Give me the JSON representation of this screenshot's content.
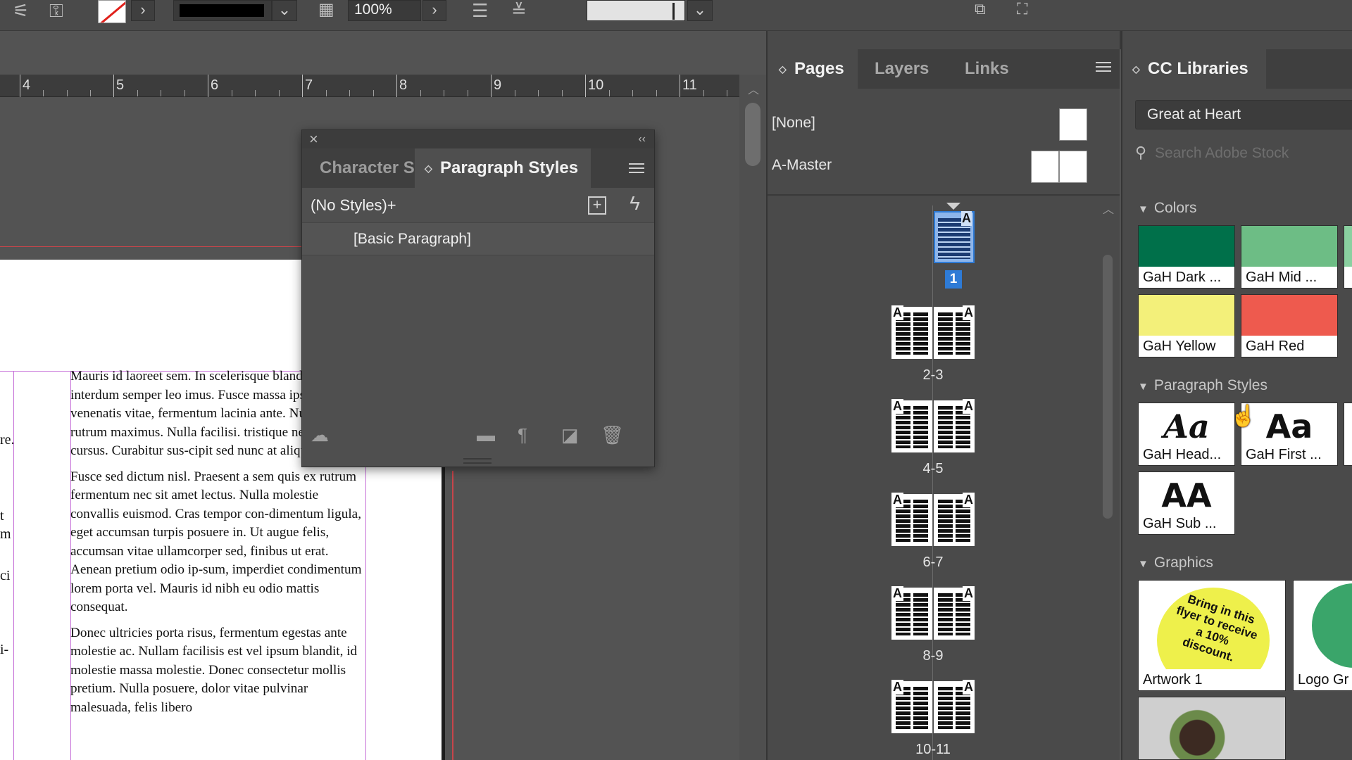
{
  "toolbar": {
    "zoom": "100%"
  },
  "ruler": {
    "labels": [
      "4",
      "5",
      "6",
      "7",
      "8",
      "9",
      "10",
      "11"
    ]
  },
  "document": {
    "left_fragments": [
      "re.",
      "t",
      "m",
      "ci",
      "i-"
    ],
    "paragraphs": [
      "Mauris id laoreet sem. In scelerisque blandit. Donec interdum semper leo imus. Fusce massa ipsum, venenatis vitae, fermentum lacinia ante. Nunc arcu rutrum maximus. Nulla facilisi. tristique nec ante quis cursus. Curabitur sus-cipit sed nunc at aliquet.",
      "Fusce sed dictum nisl. Praesent a sem quis ex rutrum fermentum nec sit amet lectus. Nulla molestie convallis euismod. Cras tempor con-dimentum ligula, eget accumsan turpis posuere in. Ut augue felis, accumsan vitae ullamcorper sed, finibus ut erat. Aenean pretium odio ip-sum, imperdiet condimentum lorem porta vel. Mauris id nibh eu odio mattis consequat.",
      "Donec ultricies porta risus, fermentum egestas ante molestie ac. Nullam facilisis est vel ipsum blandit, id molestie massa molestie. Donec consectetur mollis pretium. Nulla posuere, dolor vitae pulvinar malesuada, felis libero"
    ]
  },
  "paragraph_panel": {
    "tab_character": "Character S",
    "tab_paragraph": "Paragraph Styles",
    "no_styles": "(No Styles)+",
    "items": [
      "[Basic Paragraph]"
    ]
  },
  "pages_panel": {
    "tabs": [
      "Pages",
      "Layers",
      "Links"
    ],
    "masters": [
      "[None]",
      "A-Master"
    ],
    "page1_label": "1",
    "spread_labels": [
      "2-3",
      "4-5",
      "6-7",
      "8-9",
      "10-11"
    ],
    "page_letter": "A"
  },
  "cc_panel": {
    "tab": "CC Libraries",
    "library": "Great at Heart",
    "search_placeholder": "Search Adobe Stock",
    "sections": {
      "colors": "Colors",
      "paragraph_styles": "Paragraph Styles",
      "graphics": "Graphics"
    },
    "colors": [
      {
        "name": "GaH Dark ...",
        "hex": "#00704a"
      },
      {
        "name": "GaH Mid ...",
        "hex": "#6dbd85"
      },
      {
        "name": "GaH Yellow",
        "hex": "#f3f07a"
      },
      {
        "name": "GaH Red",
        "hex": "#ee5a4e"
      }
    ],
    "paragraph_styles": [
      {
        "name": "GaH Head...",
        "glyph": "Aa"
      },
      {
        "name": "GaH First ...",
        "glyph": "Aa"
      },
      {
        "name": "GaH Sub ...",
        "glyph": "AA"
      }
    ],
    "graphics": [
      {
        "name": "Artwork 1",
        "text": "Bring in this flyer to receive a 10% discount."
      },
      {
        "name": "Logo Gr"
      }
    ]
  }
}
